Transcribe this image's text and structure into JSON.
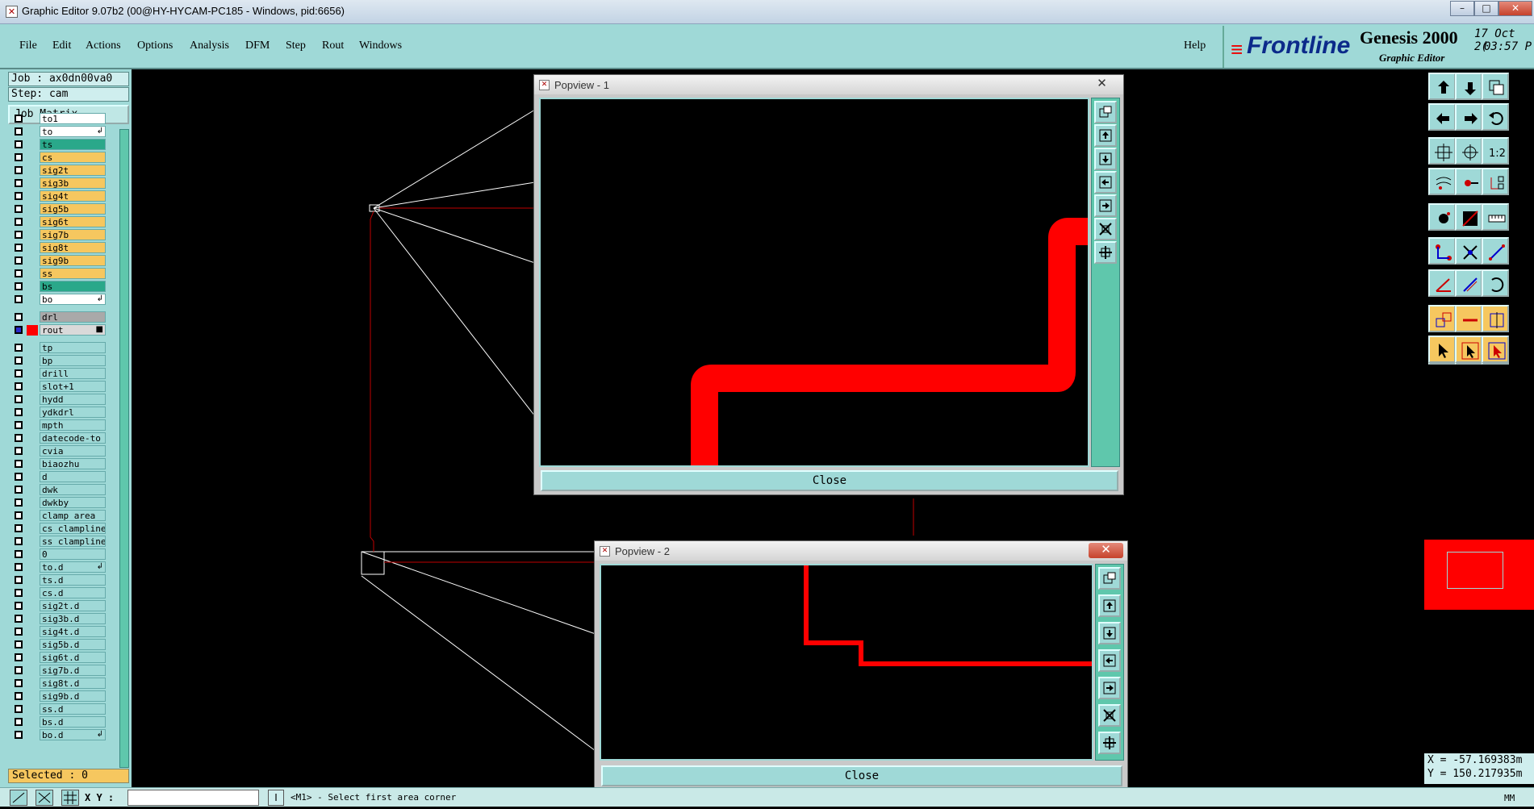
{
  "window": {
    "title": "Graphic Editor 9.07b2 (00@HY-HYCAM-PC185 - Windows, pid:6656)",
    "min": "–",
    "max": "□",
    "close": "✕"
  },
  "menu": {
    "file": "File",
    "edit": "Edit",
    "actions": "Actions",
    "options": "Options",
    "analysis": "Analysis",
    "dfm": "DFM",
    "step": "Step",
    "rout": "Rout",
    "windows": "Windows",
    "help": "Help"
  },
  "brand": {
    "logo": "Frontline",
    "product": "Genesis 2000",
    "sub": "Graphic Editor",
    "date": "17 Oct 2(",
    "time": "03:57 P"
  },
  "job": {
    "job": "Job : ax0dn00va0",
    "step": "Step: cam",
    "matrix": "Job Matrix ..."
  },
  "layers": [
    {
      "name": "to1",
      "color": "#ffffff"
    },
    {
      "name": "to",
      "color": "#ffffff",
      "mark": "↲"
    },
    {
      "name": "ts",
      "color": "#2aa88a"
    },
    {
      "name": "cs",
      "color": "#f6c75f"
    },
    {
      "name": "sig2t",
      "color": "#f6c75f"
    },
    {
      "name": "sig3b",
      "color": "#f6c75f"
    },
    {
      "name": "sig4t",
      "color": "#f6c75f"
    },
    {
      "name": "sig5b",
      "color": "#f6c75f"
    },
    {
      "name": "sig6t",
      "color": "#f6c75f"
    },
    {
      "name": "sig7b",
      "color": "#f6c75f"
    },
    {
      "name": "sig8t",
      "color": "#f6c75f"
    },
    {
      "name": "sig9b",
      "color": "#f6c75f"
    },
    {
      "name": "ss",
      "color": "#f6c75f"
    },
    {
      "name": "bs",
      "color": "#2aa88a"
    },
    {
      "name": "bo",
      "color": "#ffffff",
      "mark": "↲"
    },
    {
      "name": "drl",
      "color": "#a9a9a9"
    },
    {
      "name": "rout",
      "color": "#d9d9d9",
      "swatch": "#ff0000",
      "mark": "■",
      "active": true
    },
    {
      "name": "tp",
      "color": "#9fd9d7"
    },
    {
      "name": "bp",
      "color": "#9fd9d7"
    },
    {
      "name": "drill",
      "color": "#9fd9d7"
    },
    {
      "name": "slot+1",
      "color": "#9fd9d7"
    },
    {
      "name": "hydd",
      "color": "#9fd9d7"
    },
    {
      "name": "ydkdrl",
      "color": "#9fd9d7"
    },
    {
      "name": "mpth",
      "color": "#9fd9d7"
    },
    {
      "name": "datecode-to",
      "color": "#9fd9d7"
    },
    {
      "name": "cvia",
      "color": "#9fd9d7"
    },
    {
      "name": "biaozhu",
      "color": "#9fd9d7"
    },
    {
      "name": "d",
      "color": "#9fd9d7"
    },
    {
      "name": "dwk",
      "color": "#9fd9d7"
    },
    {
      "name": "dwkby",
      "color": "#9fd9d7"
    },
    {
      "name": "clamp_area",
      "color": "#9fd9d7"
    },
    {
      "name": "cs_clampline",
      "color": "#9fd9d7"
    },
    {
      "name": "ss_clampline",
      "color": "#9fd9d7"
    },
    {
      "name": "0",
      "color": "#9fd9d7"
    },
    {
      "name": "to.d",
      "color": "#9fd9d7",
      "mark": "↲"
    },
    {
      "name": "ts.d",
      "color": "#9fd9d7"
    },
    {
      "name": "cs.d",
      "color": "#9fd9d7"
    },
    {
      "name": "sig2t.d",
      "color": "#9fd9d7"
    },
    {
      "name": "sig3b.d",
      "color": "#9fd9d7"
    },
    {
      "name": "sig4t.d",
      "color": "#9fd9d7"
    },
    {
      "name": "sig5b.d",
      "color": "#9fd9d7"
    },
    {
      "name": "sig6t.d",
      "color": "#9fd9d7"
    },
    {
      "name": "sig7b.d",
      "color": "#9fd9d7"
    },
    {
      "name": "sig8t.d",
      "color": "#9fd9d7"
    },
    {
      "name": "sig9b.d",
      "color": "#9fd9d7"
    },
    {
      "name": "ss.d",
      "color": "#9fd9d7"
    },
    {
      "name": "bs.d",
      "color": "#9fd9d7"
    },
    {
      "name": "bo.d",
      "color": "#9fd9d7",
      "mark": "↲"
    }
  ],
  "selected": "Selected : 0",
  "coords": {
    "x": "X = -57.169383m",
    "y": "Y = 150.217935m"
  },
  "popup1": {
    "title": "Popview - 1",
    "close": "Close"
  },
  "popup2": {
    "title": "Popview - 2",
    "close": "Close"
  },
  "status": {
    "xy": "X Y :",
    "message": "<M1> - Select first area corner",
    "units": "MM"
  },
  "colors": {
    "accent": "#9fd9d7",
    "trace": "#ff0000",
    "highlight": "#f6c75f"
  }
}
